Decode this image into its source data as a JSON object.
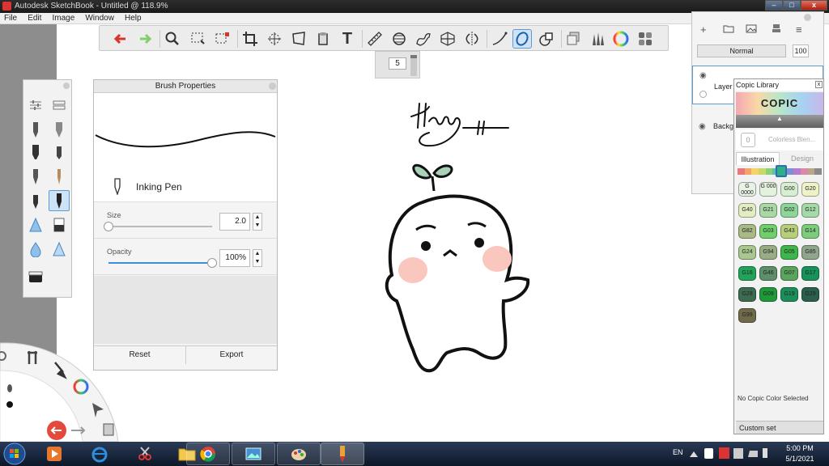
{
  "window": {
    "title": "Autodesk SketchBook - Untitled @ 118.9%",
    "close_glyph": "x",
    "min_glyph": "–",
    "max_glyph": "□"
  },
  "menu": [
    "File",
    "Edit",
    "Image",
    "Window",
    "Help"
  ],
  "toolbar": {
    "tools": [
      "undo-icon",
      "redo-icon",
      "zoom-icon",
      "select-icon",
      "lasso-select-icon",
      "crop-icon",
      "move-icon",
      "distort-icon",
      "fill-icon",
      "text-icon",
      "ruler-icon",
      "ellipse-guide-icon",
      "french-curve-icon",
      "perspective-icon",
      "symmetry-icon",
      "stroke-icon",
      "ellipse-tool-icon",
      "shape-tool-icon",
      "layers-icon",
      "brushes-icon",
      "color-wheel-icon",
      "copic-icon"
    ],
    "active_tool": "ellipse-tool-icon",
    "text_tool_glyph": "T",
    "size_value": "5"
  },
  "brush_properties": {
    "title": "Brush Properties",
    "brush_name": "Inking Pen",
    "size_label": "Size",
    "size_value": "2.0",
    "size_fraction": 0.0,
    "opacity_label": "Opacity",
    "opacity_value": "100%",
    "opacity_fraction": 1.0,
    "reset_label": "Reset",
    "export_label": "Export",
    "spin_up": "▲",
    "spin_down": "▼"
  },
  "layers": {
    "blend_mode": "Normal",
    "opacity": "100",
    "items": [
      "Layer",
      "Backg"
    ]
  },
  "copic": {
    "title": "Copic Library",
    "logo": "COPIC",
    "colorless_label": "Colorless Blen...",
    "colorless_code": "0",
    "tabs": [
      "Illustration",
      "Design"
    ],
    "active_tab": "Illustration",
    "swatches": [
      {
        "code": "G 0000",
        "color": "#e8f3e6"
      },
      {
        "code": "G 000",
        "color": "#e2f2dd"
      },
      {
        "code": "G00",
        "color": "#d6efd0"
      },
      {
        "code": "G20",
        "color": "#eef3c8"
      },
      {
        "code": "G40",
        "color": "#e2edc2"
      },
      {
        "code": "G21",
        "color": "#a9d8a4"
      },
      {
        "code": "G02",
        "color": "#8ed59a"
      },
      {
        "code": "G12",
        "color": "#a6d9a9"
      },
      {
        "code": "G82",
        "color": "#a8ba86"
      },
      {
        "code": "G03",
        "color": "#6fcf6a"
      },
      {
        "code": "G43",
        "color": "#b7cf7b"
      },
      {
        "code": "G14",
        "color": "#7ccc7b"
      },
      {
        "code": "G24",
        "color": "#a9c78f"
      },
      {
        "code": "G94",
        "color": "#9aac85"
      },
      {
        "code": "G05",
        "color": "#3fb64c"
      },
      {
        "code": "G85",
        "color": "#8fa58c"
      },
      {
        "code": "G16",
        "color": "#22a35a"
      },
      {
        "code": "G46",
        "color": "#5d8f6a"
      },
      {
        "code": "G07",
        "color": "#5aa45b"
      },
      {
        "code": "G17",
        "color": "#17925a"
      },
      {
        "code": "G28",
        "color": "#3d6b52"
      },
      {
        "code": "G09",
        "color": "#1e9a3a"
      },
      {
        "code": "G19",
        "color": "#1b8f5a"
      },
      {
        "code": "G29",
        "color": "#2b5e4c"
      },
      {
        "code": "G99",
        "color": "#6f6a4a"
      }
    ],
    "strip_colors": [
      "#e8787a",
      "#f2a56a",
      "#f7d26a",
      "#c8d96a",
      "#8ccf7a",
      "#5fbfa8",
      "#5aa9d6",
      "#7f8fd6",
      "#b27ccf",
      "#d98aa6",
      "#b8a58a",
      "#8a8a8a"
    ],
    "status": "No Copic Color Selected",
    "custom_set": "Custom set",
    "collapse_glyph": "▲"
  },
  "taskbar": {
    "language": "EN",
    "time": "5:00 PM",
    "date": "5/1/2021"
  },
  "colors": {
    "accent": "#3b8ed8",
    "undo": "#d9342b",
    "redo": "#7fcf6e"
  }
}
